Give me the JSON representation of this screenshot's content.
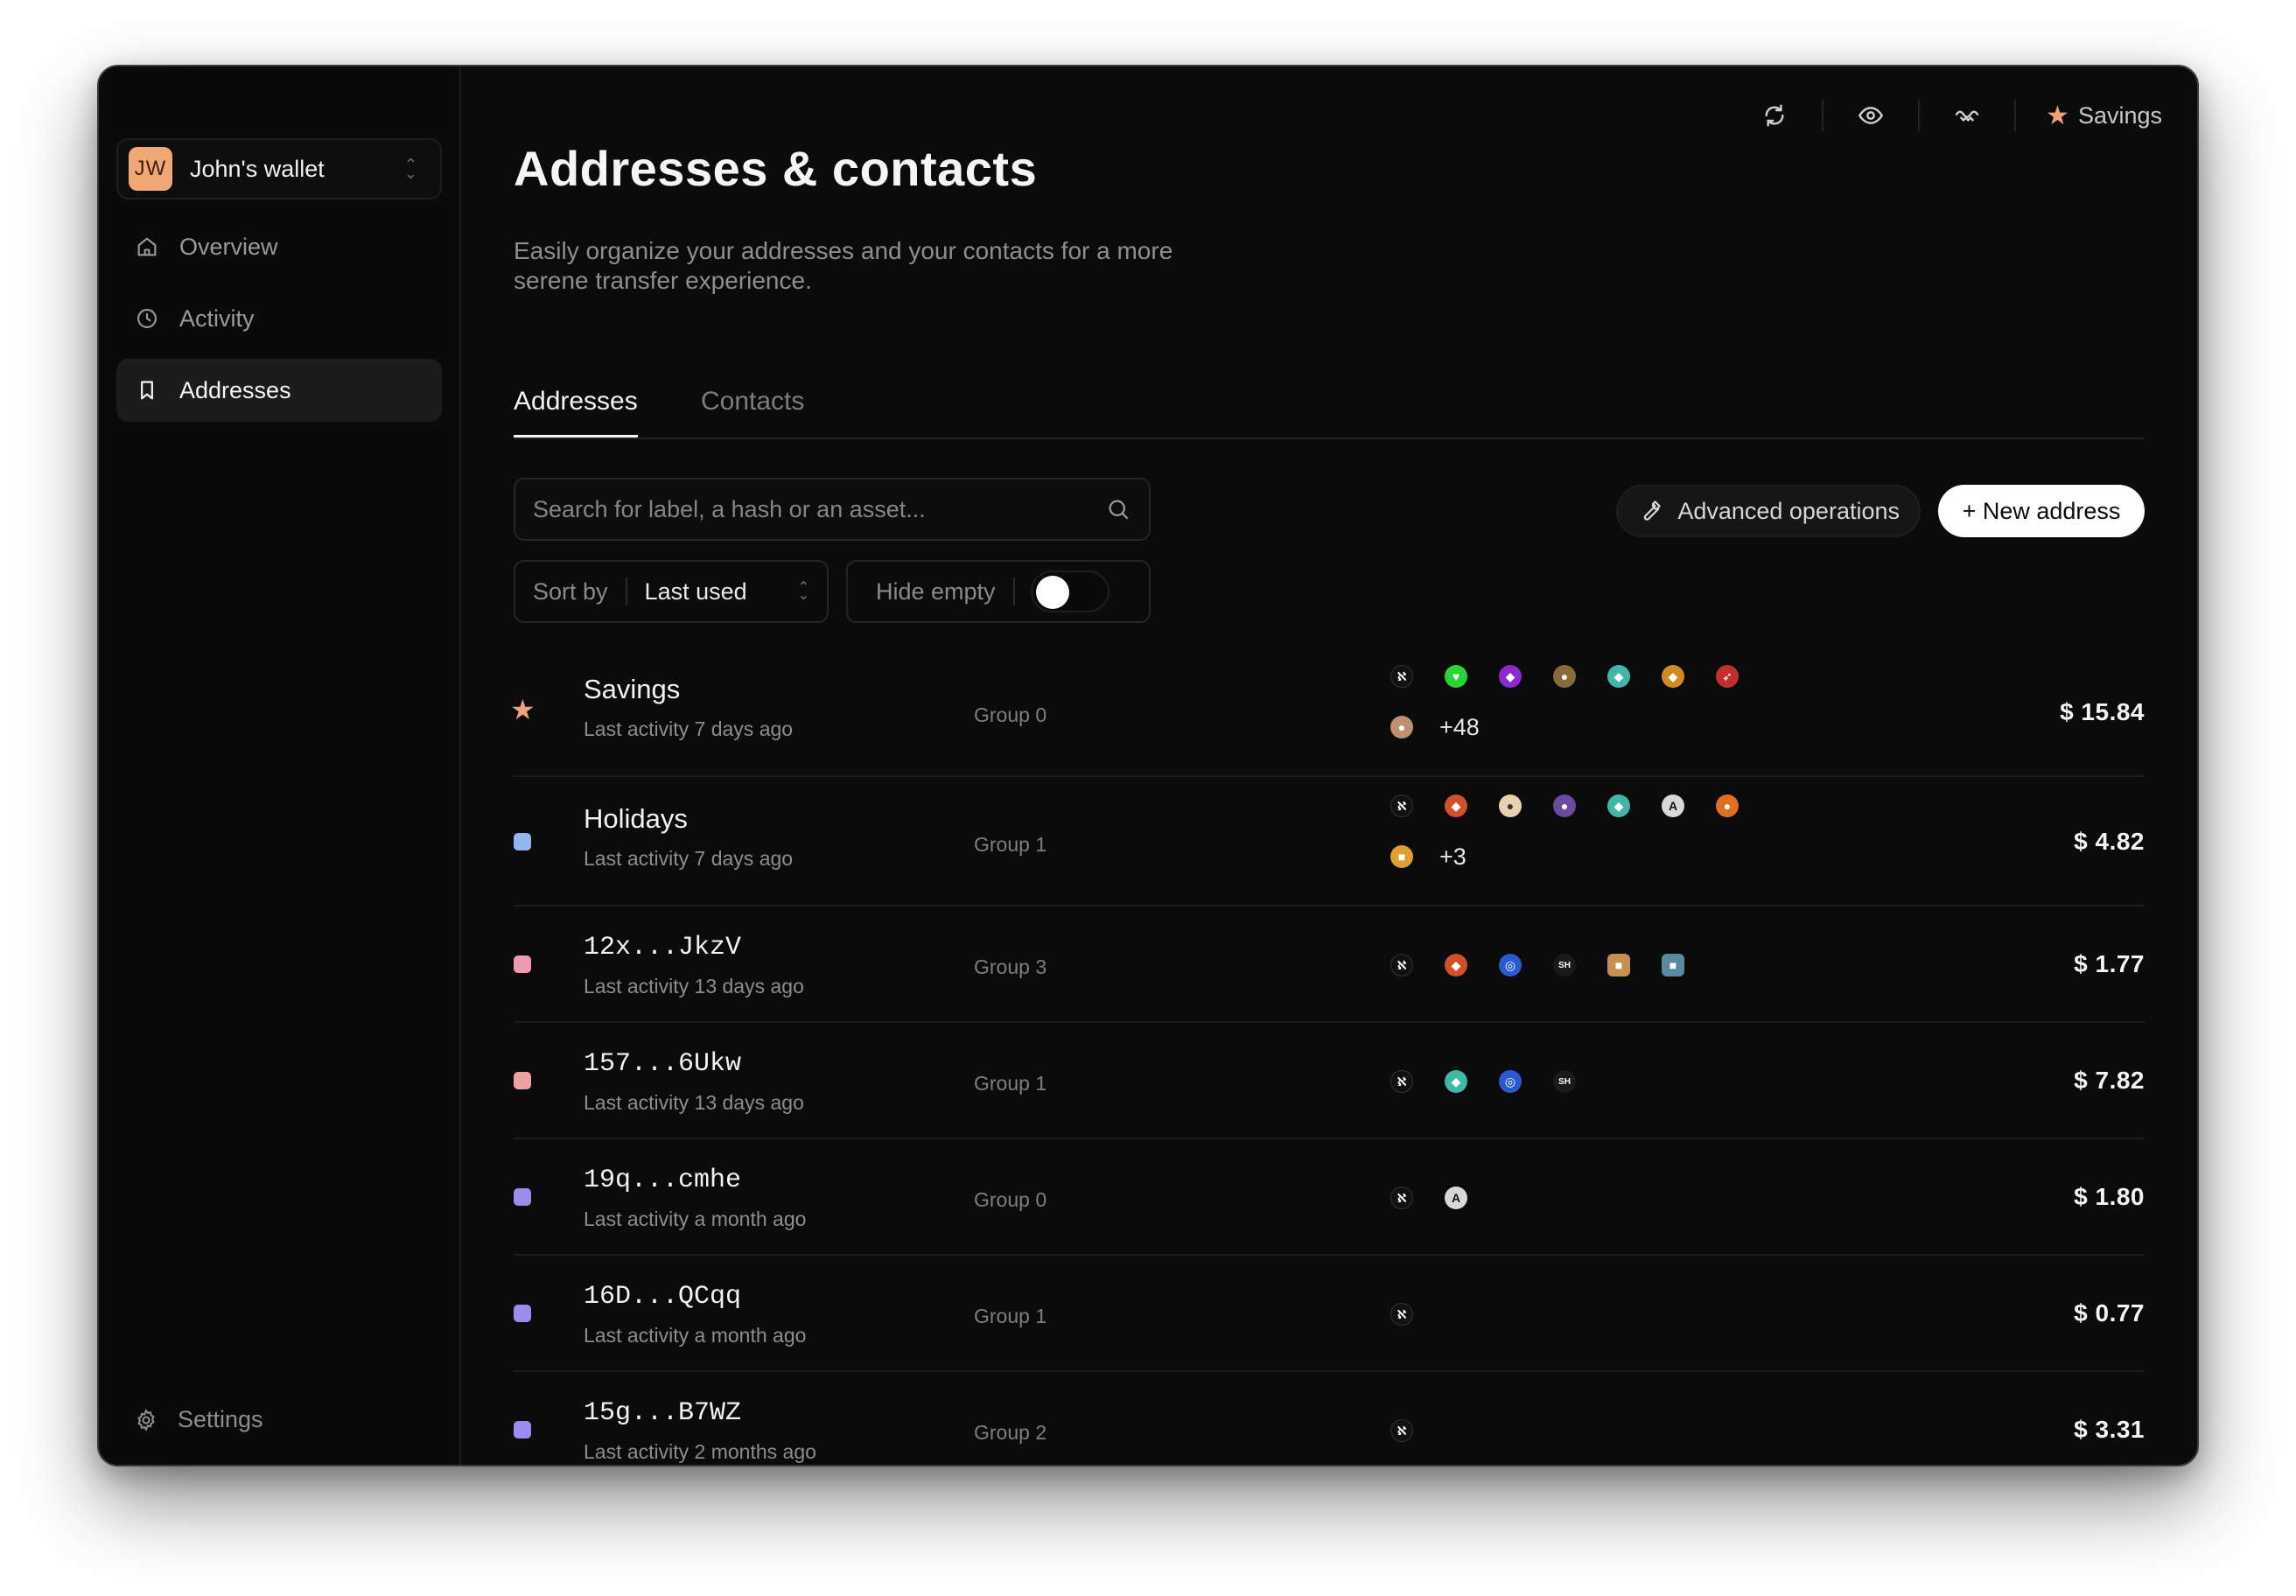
{
  "sidebar": {
    "wallet": {
      "initials": "JW",
      "name": "John's wallet"
    },
    "nav": [
      {
        "label": "Overview",
        "icon": "home-icon",
        "active": false
      },
      {
        "label": "Activity",
        "icon": "clock-icon",
        "active": false
      },
      {
        "label": "Addresses",
        "icon": "bookmark-icon",
        "active": true
      }
    ],
    "settings_label": "Settings"
  },
  "topbar": {
    "icons": [
      "refresh-icon",
      "eye-icon",
      "wave-icon"
    ],
    "favorite_label": "Savings"
  },
  "header": {
    "title": "Addresses & contacts",
    "subtitle": "Easily organize your addresses and your contacts for a more serene transfer experience."
  },
  "tabs": [
    {
      "label": "Addresses",
      "active": true
    },
    {
      "label": "Contacts",
      "active": false
    }
  ],
  "toolbar": {
    "search_placeholder": "Search for label, a hash or an asset...",
    "advanced_label": "Advanced operations",
    "new_address_label": "+ New address",
    "sort_label": "Sort by",
    "sort_value": "Last used",
    "hide_empty_label": "Hide empty",
    "hide_empty_enabled": false
  },
  "colors": {
    "accent_star": "#f0a07a",
    "blue": "#8fb7f0",
    "pink": "#f09ab0",
    "salmon": "#f0a0a0",
    "purple": "#9b8cf0"
  },
  "addresses": [
    {
      "name": "Savings",
      "activity": "Last activity 7 days ago",
      "group": "Group 0",
      "amount": "$ 15.84",
      "marker": "star",
      "extra": "+48"
    },
    {
      "name": "Holidays",
      "activity": "Last activity 7 days ago",
      "group": "Group 1",
      "amount": "$ 4.82",
      "marker": "#8fb7f0",
      "extra": "+3"
    },
    {
      "name": "12x...JkzV",
      "activity": "Last activity 13 days ago",
      "group": "Group 3",
      "amount": "$ 1.77",
      "marker": "#f09ab0"
    },
    {
      "name": "157...6Ukw",
      "activity": "Last activity 13 days ago",
      "group": "Group 1",
      "amount": "$ 7.82",
      "marker": "#f0a0a0"
    },
    {
      "name": "19q...cmhe",
      "activity": "Last activity a month ago",
      "group": "Group 0",
      "amount": "$ 1.80",
      "marker": "#9b8cf0"
    },
    {
      "name": "16D...QCqq",
      "activity": "Last activity a month ago",
      "group": "Group 1",
      "amount": "$ 0.77",
      "marker": "#9b8cf0"
    },
    {
      "name": "15g...B7WZ",
      "activity": "Last activity 2 months ago",
      "group": "Group 2",
      "amount": "$ 3.31",
      "marker": "#9b8cf0"
    }
  ]
}
